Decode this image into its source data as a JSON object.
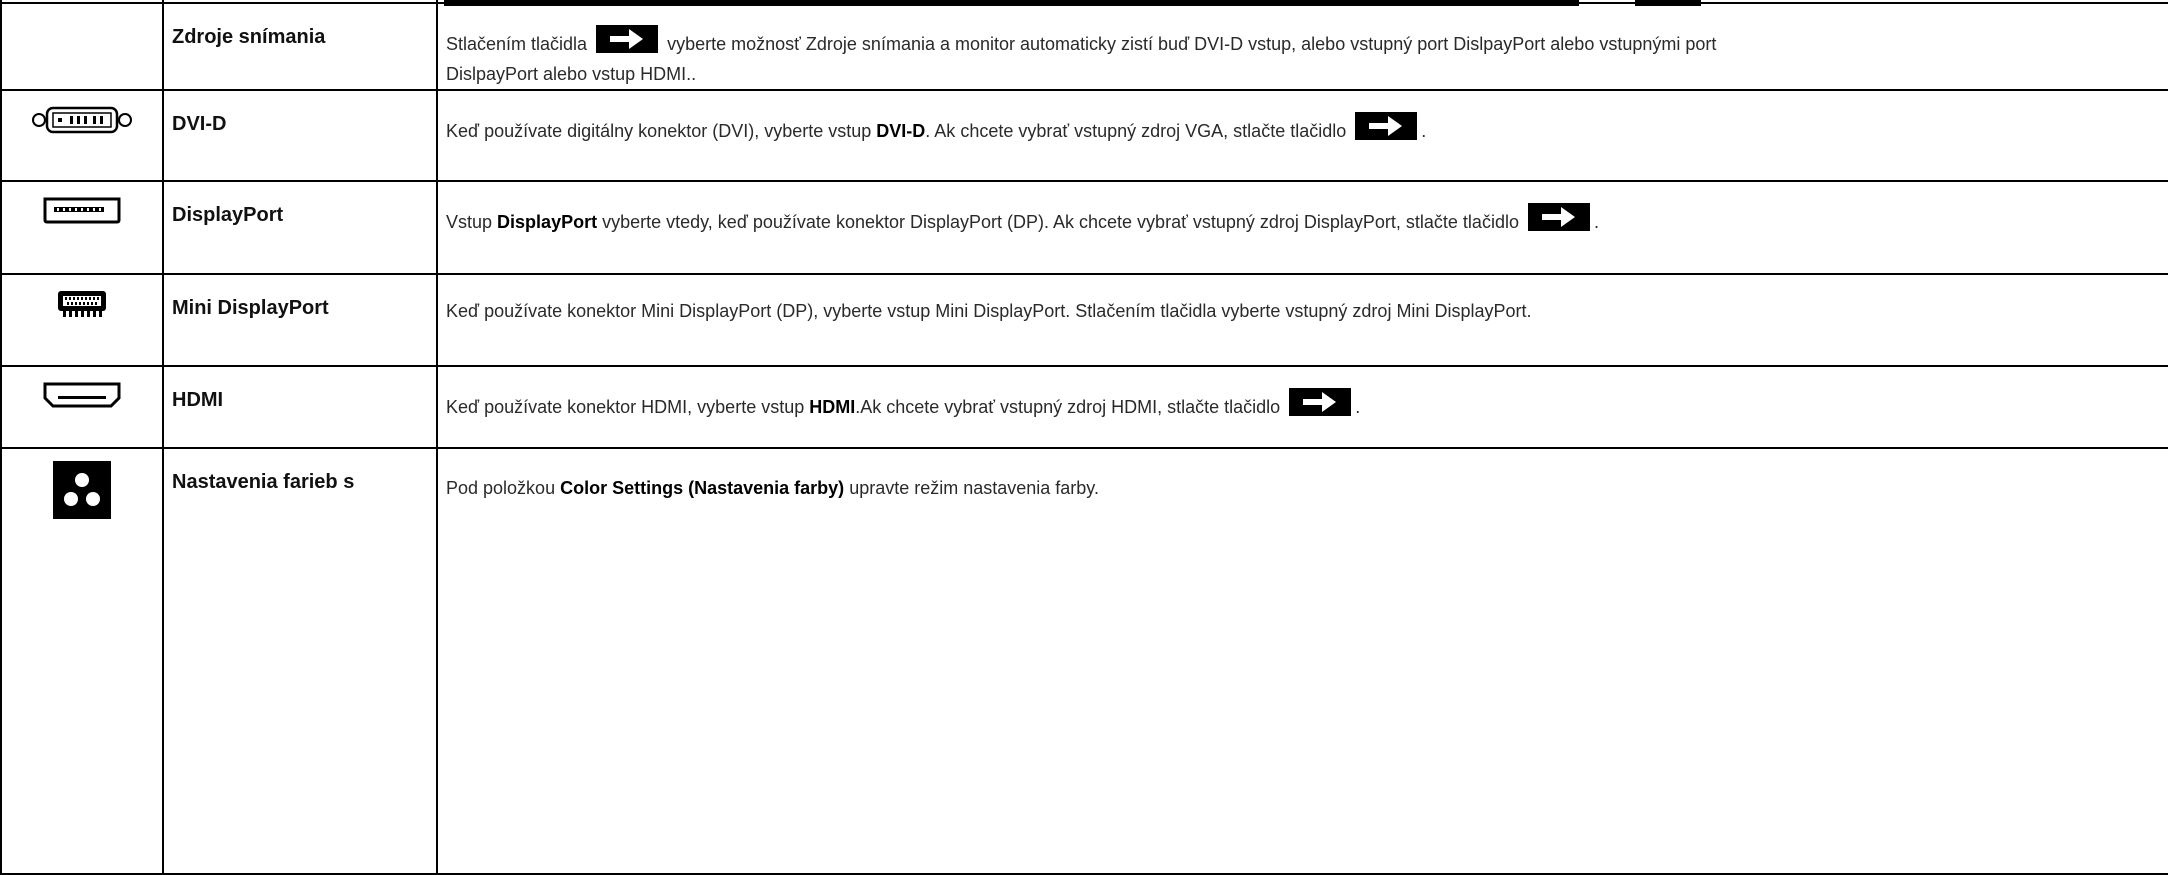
{
  "rows": [
    {
      "name": "Zdroje snímania",
      "icon": "none",
      "desc": {
        "t1": "Stlačením tlačidla",
        "t2": "vyberte možnosť Zdroje snímania a monitor automaticky zistí buď DVI-D vstup, alebo vstupný port DislpayPort alebo vstupnými port",
        "t3": "DislpayPort alebo vstup HDMI.."
      }
    },
    {
      "name": "DVI-D",
      "icon": "dvi-connector-icon",
      "desc": {
        "t1": "Keď používate digitálny konektor (DVI), vyberte vstup",
        "b1": "DVI-D",
        "t2": ". Ak chcete vybrať vstupný zdroj VGA, stlačte tlačidlo",
        "t3": "."
      }
    },
    {
      "name": "DisplayPort",
      "icon": "displayport-connector-icon",
      "desc": {
        "t1": "Vstup",
        "b1": "DisplayPort",
        "t2": "vyberte vtedy, keď používate konektor DisplayPort (DP). Ak chcete vybrať vstupný zdroj DisplayPort, stlačte tlačidlo",
        "t3": "."
      }
    },
    {
      "name": "Mini DisplayPort",
      "icon": "mini-displayport-connector-icon",
      "desc": {
        "t1": "Keď používate konektor Mini DisplayPort (DP), vyberte vstup Mini DisplayPort. Stlačením tlačidla vyberte vstupný zdroj Mini DisplayPort."
      }
    },
    {
      "name": "HDMI",
      "icon": "hdmi-connector-icon",
      "desc": {
        "t1": "Keď používate konektor HDMI, vyberte vstup",
        "b1": "HDMI",
        "t2": ".Ak chcete vybrať vstupný zdroj HDMI, stlačte tlačidlo",
        "t3": "."
      }
    },
    {
      "name": "Nastavenia farieb s",
      "icon": "color-settings-icon",
      "desc": {
        "t1": "Pod položkou",
        "b1": "Color Settings (Nastavenia farby)",
        "t2": "upravte režim nastavenia farby."
      }
    }
  ],
  "colors": {
    "border": "#000000",
    "button": "#000000",
    "text": "#2a2a2a"
  },
  "button_icon": "arrow-right-icon"
}
